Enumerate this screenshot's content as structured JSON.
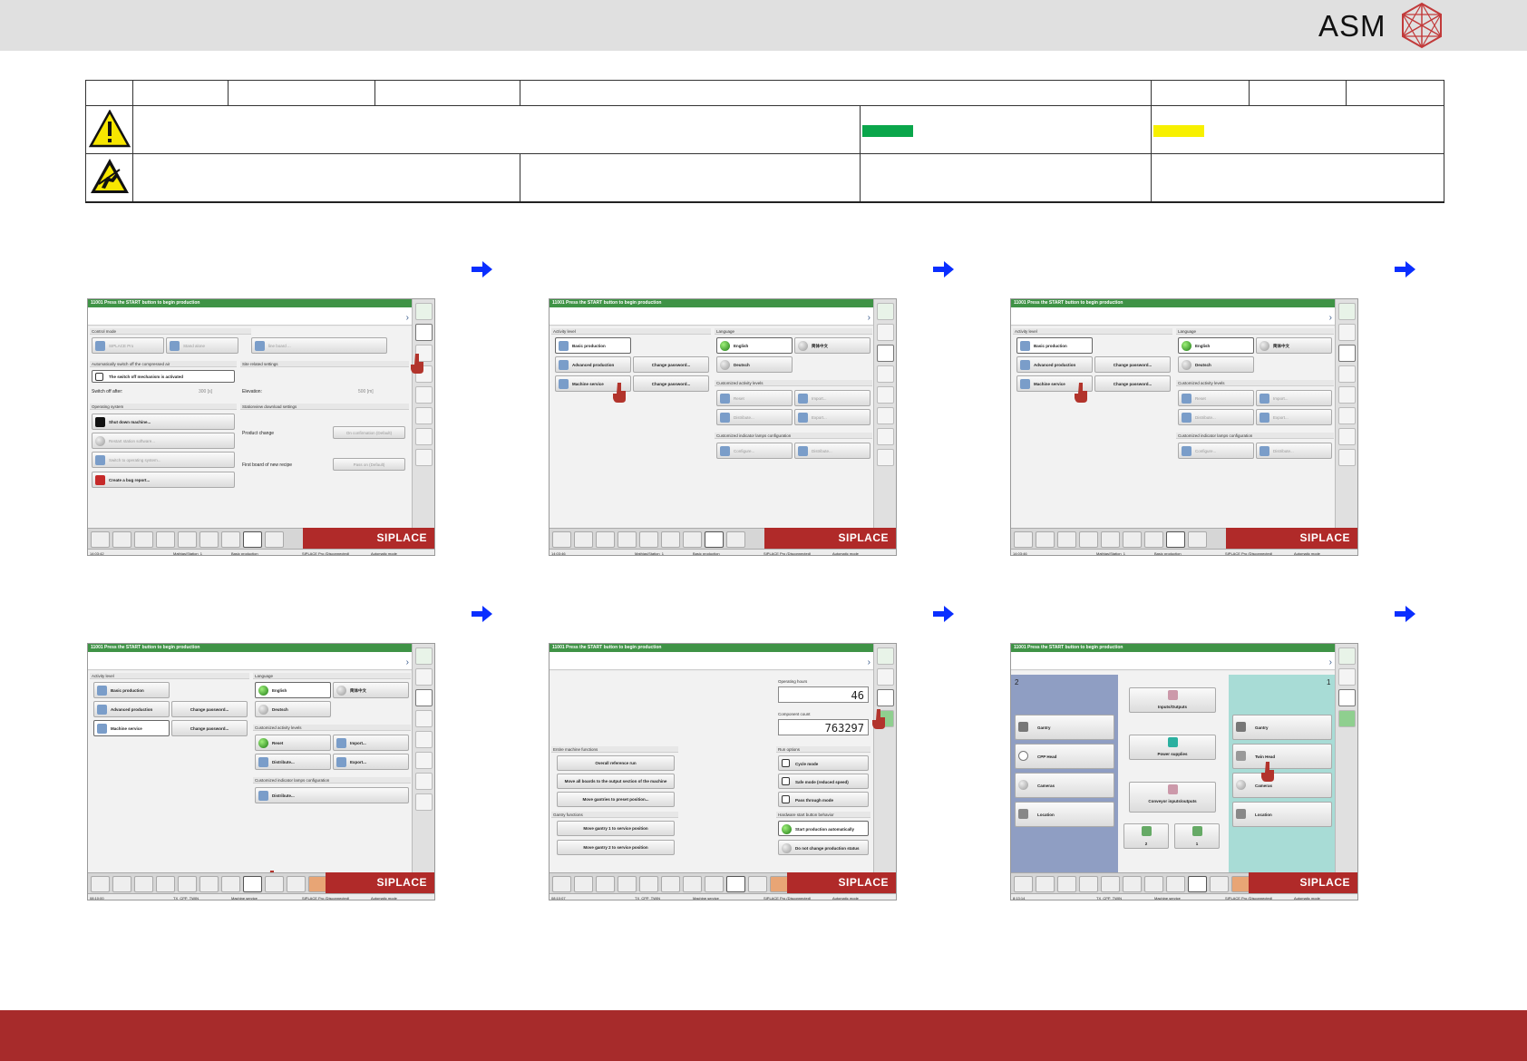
{
  "brand": {
    "logo_text": "ASM"
  },
  "colors": {
    "green_badge": "#0aa64b",
    "yellow_badge": "#f7f000",
    "footer": "#a72b2b",
    "arrow": "#0a2eff"
  },
  "screens": [
    {
      "status_message": "11001 Press the START button to begin production",
      "brand": "SIPLACE",
      "statusbar": {
        "left": "14:03:42",
        "station": "Mathias\\Station_1",
        "level": "Basic production",
        "conn": "SIPLACE Pro (Disconnected)",
        "mode": "Automatic mode"
      },
      "sections": {
        "control_mode": "Control mode",
        "auto_switch": "Automatically switch off the compressed air",
        "site": "Site related settings",
        "os": "Operating system",
        "stationview": "Stationview download settings"
      },
      "buttons": {
        "siplace_pro": "SIPLACE Pro",
        "stand_alone": "Stand alone",
        "line_board": "line board ...",
        "switch_off_active": "The switch off mechanism is activated",
        "switch_off_after": "Switch off after:",
        "switch_val": "300 [s]",
        "elevation": "Elevation:",
        "elev_val": "500 [m]",
        "shutdown": "Shut down machine...",
        "restart": "Restart station software...",
        "switch_os": "Switch to operating system...",
        "bug": "Create a bug report...",
        "product_change": "Product change",
        "product_change_val": "On confirmation (Default)",
        "first_board": "First board of new recipe",
        "first_board_val": "Pass on (Default)"
      }
    },
    {
      "status_message": "11001 Press the START button to begin production",
      "brand": "SIPLACE",
      "statusbar": {
        "left": "14:03:46",
        "station": "Mathias\\Station_1",
        "level": "Basic production",
        "conn": "SIPLACE Pro (Disconnected)",
        "mode": "Automatic mode"
      },
      "sections": {
        "activity": "Activity level",
        "language": "Language",
        "custom": "Customized activity levels",
        "lamps": "Customized indicator lamps configuration"
      },
      "buttons": {
        "basic": "Basic production",
        "advanced": "Advanced production",
        "service": "Machine service",
        "change_pw": "Change password...",
        "english": "English",
        "chinese": "简体中文",
        "deutsch": "Deutsch",
        "reset": "Reset",
        "import": "Import...",
        "distribute": "Distribute...",
        "export": "Export...",
        "configure": "Configure...",
        "lamp_distribute": "Distribute..."
      }
    },
    {
      "status_message": "11001 Press the START button to begin production",
      "brand": "SIPLACE",
      "statusbar": {
        "left": "14:03:46",
        "station": "Mathias\\Station_1",
        "level": "Basic production",
        "conn": "SIPLACE Pro (Disconnected)",
        "mode": "Automatic mode"
      }
    },
    {
      "status_message": "11001 Press the START button to begin production",
      "brand": "SIPLACE",
      "statusbar": {
        "left": "08:10:00",
        "station": "TX_CPP_TWIN",
        "level": "Machine service",
        "conn": "SIPLACE Pro (Disconnected)",
        "mode": "Automatic mode"
      }
    },
    {
      "status_message": "11001 Press the START button to begin production",
      "brand": "SIPLACE",
      "statusbar": {
        "left": "08:10:07",
        "station": "TX_CPP_TWIN",
        "level": "Machine service",
        "conn": "SIPLACE Pro (Disconnected)",
        "mode": "Automatic mode"
      },
      "sections": {
        "hours": "Operating hours",
        "count": "Component count",
        "run": "Run options",
        "hw": "Hardware start button behavior",
        "entire": "Entire machine functions",
        "gantry": "Gantry functions"
      },
      "values": {
        "hours": "46",
        "count": "763297"
      },
      "buttons": {
        "cycle": "Cycle mode",
        "safe": "Safe mode (reduced speed)",
        "pass": "Pass through mode",
        "start_auto": "Start production automatically",
        "no_change": "Do not change production status",
        "overall": "Overall reference run",
        "move_boards": "Move all boards to the output section of the machine",
        "move_preset": "Move gantries to preset position...",
        "g1": "Move gantry 1 to service position",
        "g2": "Move gantry 2 to service position"
      }
    },
    {
      "status_message": "11001 Press the START button to begin production",
      "brand": "SIPLACE",
      "statusbar": {
        "left": "8:13:14",
        "station": "TX_CPP_TWIN",
        "level": "Machine service",
        "conn": "SIPLACE Pro (Disconnected)",
        "mode": "Automatic mode"
      },
      "labels": {
        "left_no": "2",
        "right_no": "1",
        "io": "Inputs/Outputs",
        "power": "Power supplies",
        "conveyor": "Conveyor inputs/outputs",
        "gantry": "Gantry",
        "cpp": "CPP Head",
        "twin": "Twin Head",
        "cameras": "Cameras",
        "location": "Location",
        "n2": "2",
        "n1": "1"
      }
    }
  ]
}
